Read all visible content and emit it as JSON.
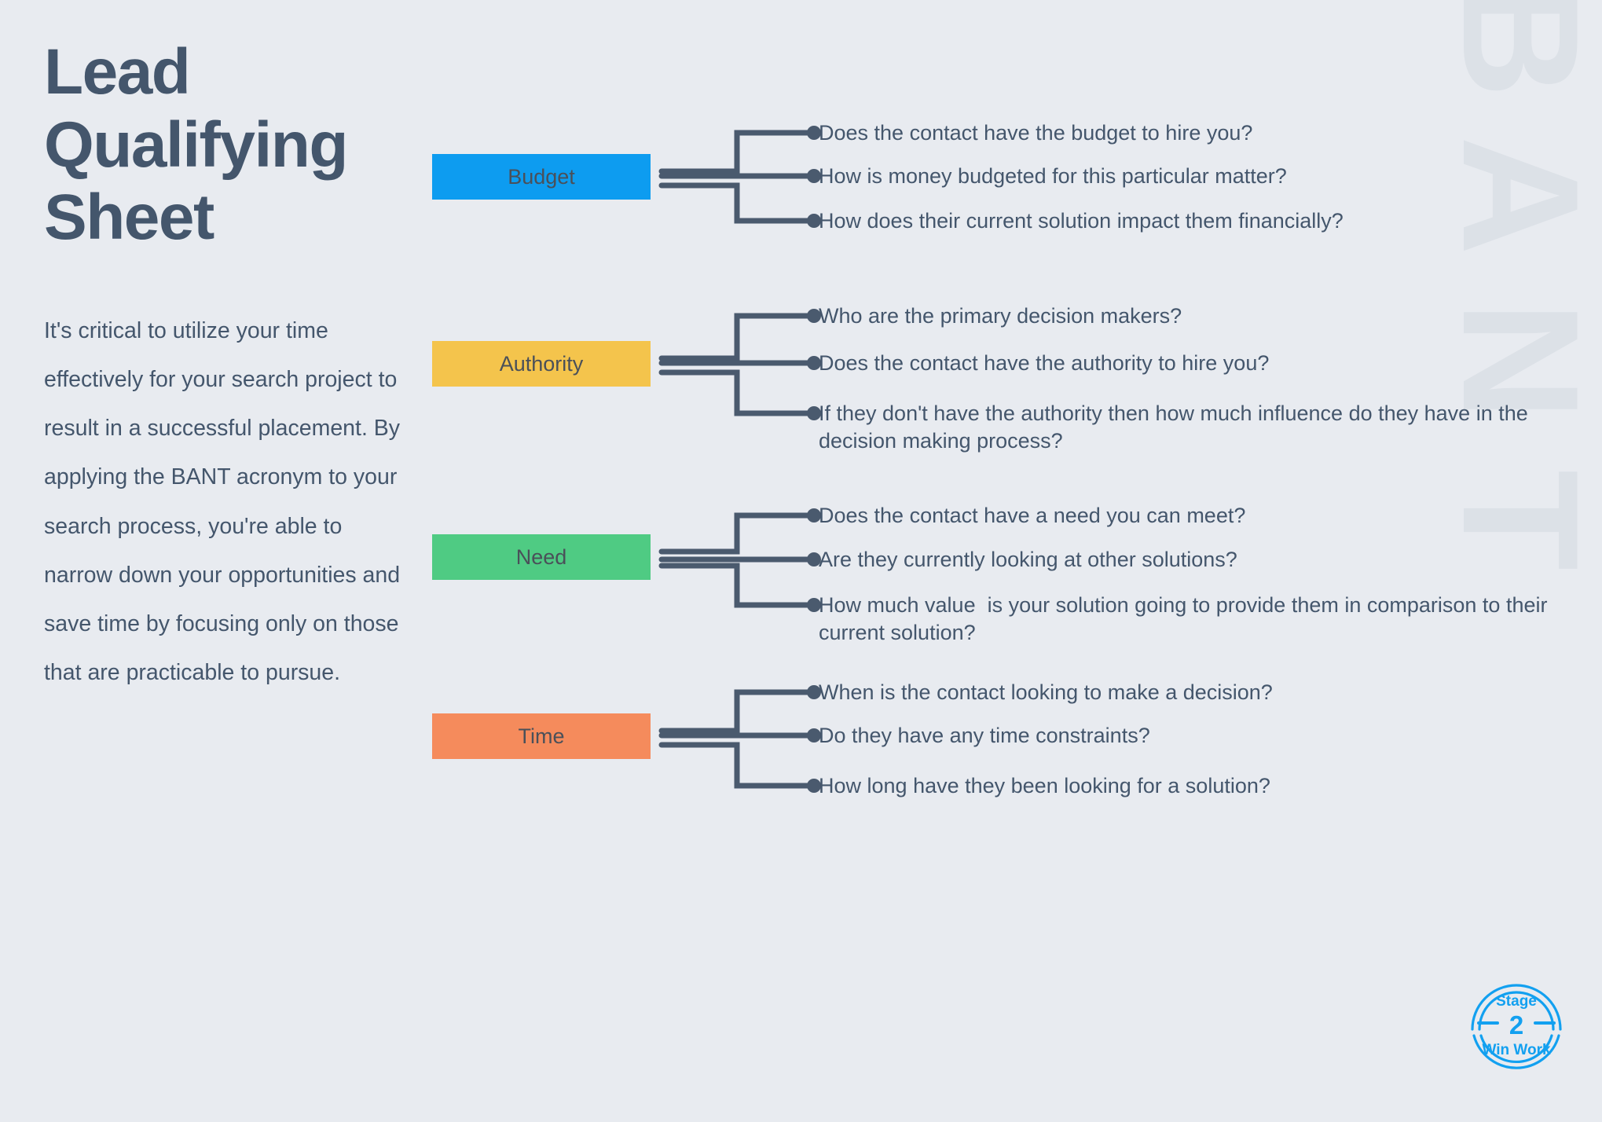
{
  "background_color": "#e8ebf0",
  "title": "Lead\nQualifying\nSheet",
  "intro_paragraph": "It's critical to utilize your time effectively for your search project to result in a successful placement. By applying the BANT acronym to your search process, you're able to narrow down your opportunities and save time by focusing only on those that are practicable to pursue.",
  "watermark": {
    "letters": [
      "B",
      "A",
      "N",
      "T"
    ],
    "color": "#dce1e7"
  },
  "connector_color": "#4a5a6e",
  "text_color": "#44566c",
  "branches": [
    {
      "label": "Budget",
      "color": "#0D9CF0",
      "questions": [
        "Does the contact have the budget to hire you?",
        "How is money budgeted for this particular matter?",
        "How does their current solution impact them financially?"
      ]
    },
    {
      "label": "Authority",
      "color": "#F4C44C",
      "questions": [
        "Who are the primary decision makers?",
        "Does the contact have the authority to hire you?",
        "If they don't have the authority then how much influence do they have in the decision making process?"
      ]
    },
    {
      "label": "Need",
      "color": "#4FCB83",
      "questions": [
        "Does the contact have a need you can meet?",
        "Are they currently looking at other solutions?",
        "How much value  is your solution going to provide them in comparison to their current solution?"
      ]
    },
    {
      "label": "Time",
      "color": "#F58B5C",
      "questions": [
        "When is the contact looking to make a decision?",
        "Do they have any time constraints?",
        "How long have they been looking for a solution?"
      ]
    }
  ],
  "stage_badge": {
    "stage_label": "Stage",
    "stage_number": "2",
    "stage_sub": "Win Work",
    "color": "#12A0F0"
  }
}
